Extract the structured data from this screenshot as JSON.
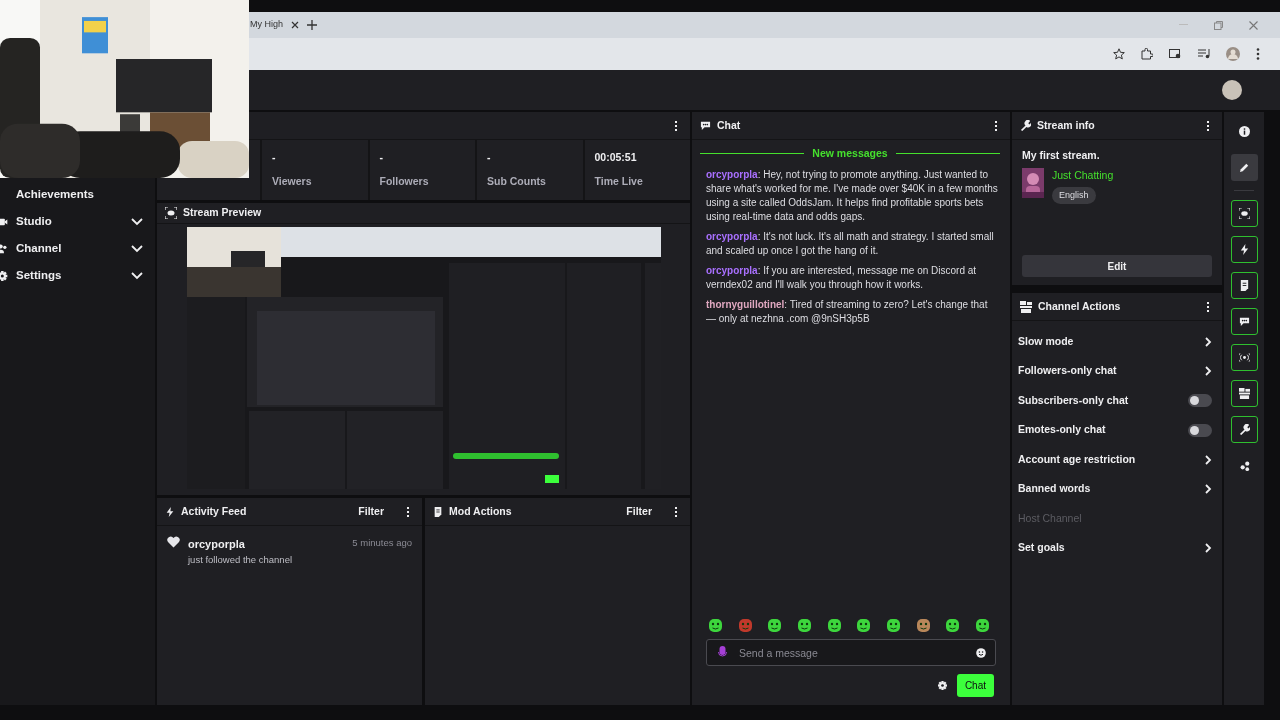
{
  "browser": {
    "tab_title": "My High"
  },
  "sidebar": {
    "items": [
      {
        "label": "Achievements",
        "kind": "link"
      },
      {
        "label": "Studio",
        "kind": "group",
        "expanded": false
      },
      {
        "label": "Channel",
        "kind": "group",
        "expanded": false
      },
      {
        "label": "Settings",
        "kind": "group",
        "expanded": false
      }
    ]
  },
  "stats_panel": {
    "stats": [
      {
        "value": "-",
        "label": "Viewers"
      },
      {
        "value": "-",
        "label": "Followers"
      },
      {
        "value": "-",
        "label": "Sub Counts"
      },
      {
        "value": "00:05:51",
        "label": "Time Live"
      }
    ]
  },
  "stream_preview": {
    "title": "Stream Preview"
  },
  "activity_feed": {
    "title": "Activity Feed",
    "filter": "Filter",
    "events": [
      {
        "user": "orcyporpla",
        "text": "just followed the channel",
        "time": "5 minutes ago"
      }
    ]
  },
  "mod_actions": {
    "title": "Mod Actions",
    "filter": "Filter"
  },
  "chat": {
    "title": "Chat",
    "divider": "New messages",
    "messages": [
      {
        "user": "orcyporpla",
        "color": "#a970ff",
        "text": ": Hey, not trying to promote anything. Just wanted to share what's worked for me. I've made over $40K in a few months using a site called OddsJam. It helps find profitable sports bets using real-time data and odds gaps."
      },
      {
        "user": "orcyporpla",
        "color": "#a970ff",
        "text": ": It's not luck. It's all math and strategy. I started small and scaled up once I got the hang of it."
      },
      {
        "user": "orcyporpla",
        "color": "#a970ff",
        "text": ": If you are interested, message me on Discord at verndex02 and I'll walk you through how it works."
      },
      {
        "user": "thornyguillotinel",
        "color": "#e0a8c0",
        "text": ": Tired of streaming to zero? Let's change that — only at nezhna .com @9nSH3p5B"
      }
    ],
    "input": {
      "placeholder": "Send a message"
    },
    "send_button": "Chat"
  },
  "stream_info": {
    "title": "Stream info",
    "stream_title": "My first stream.",
    "category": "Just Chatting",
    "tag": "English",
    "edit_button": "Edit"
  },
  "channel_actions": {
    "title": "Channel Actions",
    "items": [
      {
        "label": "Slow mode",
        "kind": "chevron"
      },
      {
        "label": "Followers-only chat",
        "kind": "chevron"
      },
      {
        "label": "Subscribers-only chat",
        "kind": "toggle",
        "on": false
      },
      {
        "label": "Emotes-only chat",
        "kind": "toggle",
        "on": false
      },
      {
        "label": "Account age restriction",
        "kind": "chevron"
      },
      {
        "label": "Banned words",
        "kind": "chevron"
      },
      {
        "label": "Host Channel",
        "kind": "disabled"
      },
      {
        "label": "Set goals",
        "kind": "chevron"
      }
    ]
  },
  "rail": {
    "buttons": [
      {
        "kind": "info",
        "selected": false,
        "pinned": false
      },
      {
        "kind": "pencil",
        "selected": true,
        "pinned": false
      },
      {
        "kind": "preview",
        "selected": false,
        "pinned": true
      },
      {
        "kind": "bolt",
        "selected": false,
        "pinned": true
      },
      {
        "kind": "note",
        "selected": false,
        "pinned": true
      },
      {
        "kind": "chat",
        "selected": false,
        "pinned": true
      },
      {
        "kind": "broadcast",
        "selected": false,
        "pinned": true
      },
      {
        "kind": "desk",
        "selected": false,
        "pinned": true
      },
      {
        "kind": "wrench",
        "selected": false,
        "pinned": true
      },
      {
        "kind": "dots",
        "selected": false,
        "pinned": false
      }
    ]
  }
}
